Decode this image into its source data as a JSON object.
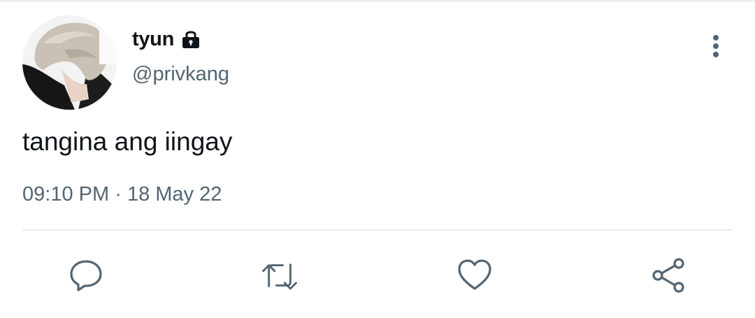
{
  "tweet": {
    "author": {
      "display_name": "tyun",
      "handle": "@privkang",
      "protected_icon": "lock-icon",
      "avatar_icon": "profile-photo"
    },
    "text": "tangina ang iingay",
    "time": "09:10 PM",
    "separator": "·",
    "date": "18 May 22"
  },
  "actions": {
    "reply_icon": "comment-bubble-icon",
    "retweet_icon": "retweet-arrows-icon",
    "like_icon": "heart-icon",
    "share_icon": "share-nodes-icon",
    "more_icon": "vertical-dots-icon"
  },
  "colors": {
    "text_primary": "#0f1419",
    "text_secondary": "#536471",
    "icon_gray": "#536471",
    "divider": "#e7ebee"
  }
}
